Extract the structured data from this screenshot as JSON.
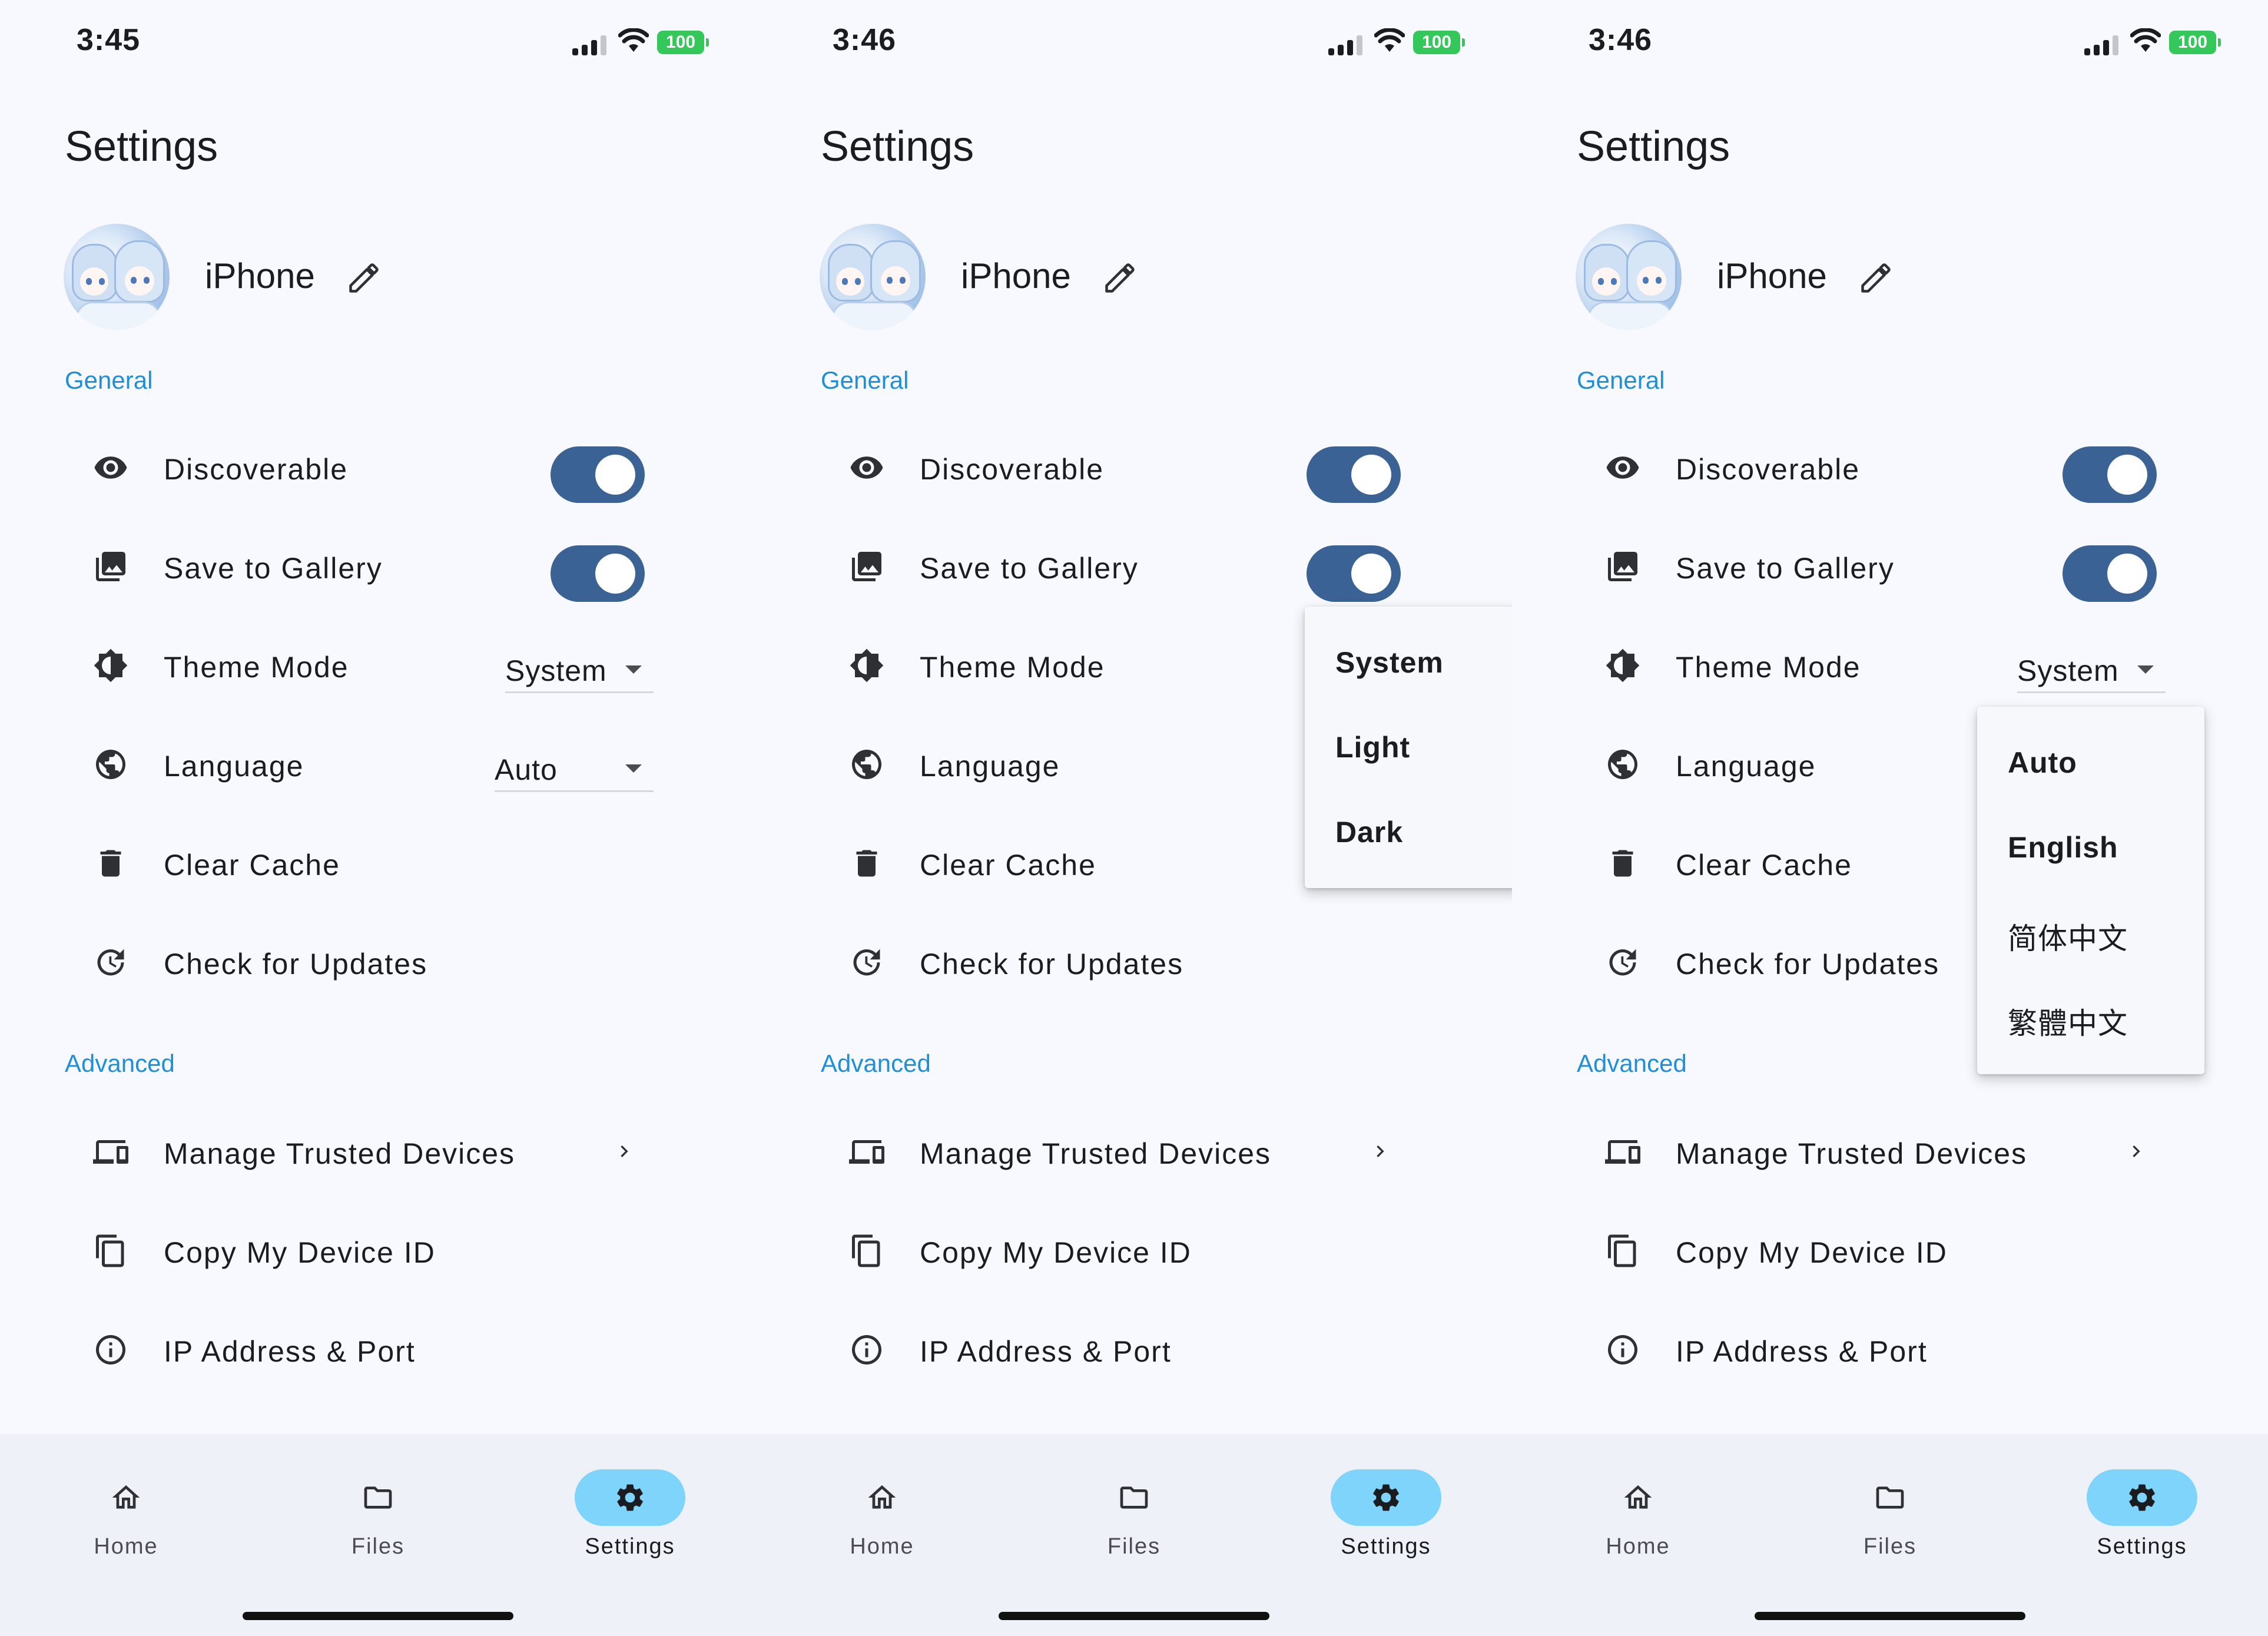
{
  "colors": {
    "accent": "#1f8fd6",
    "toggle_on": "#3a6294",
    "nav_active": "#7fd4fb",
    "battery": "#34c759"
  },
  "screens": [
    {
      "time": "3:45",
      "battery": "100",
      "title": "Settings",
      "device_name": "iPhone",
      "general_label": "General",
      "advanced_label": "Advanced",
      "discoverable": {
        "label": "Discoverable",
        "on": true
      },
      "save_to_gallery": {
        "label": "Save to Gallery",
        "on": true
      },
      "theme_mode": {
        "label": "Theme Mode",
        "value": "System"
      },
      "language": {
        "label": "Language",
        "value": "Auto"
      },
      "clear_cache": "Clear Cache",
      "check_updates": "Check for Updates",
      "manage_devices": "Manage Trusted Devices",
      "copy_id": "Copy My Device ID",
      "ip_port": "IP Address & Port",
      "nav": {
        "home": "Home",
        "files": "Files",
        "settings": "Settings"
      }
    },
    {
      "time": "3:46",
      "battery": "100",
      "title": "Settings",
      "device_name": "iPhone",
      "general_label": "General",
      "advanced_label": "Advanced",
      "discoverable": {
        "label": "Discoverable",
        "on": true
      },
      "save_to_gallery": {
        "label": "Save to Gallery",
        "on": true
      },
      "theme_mode": {
        "label": "Theme Mode"
      },
      "language": {
        "label": "Language"
      },
      "clear_cache": "Clear Cache",
      "check_updates": "Check for Updates",
      "manage_devices": "Manage Trusted Devices",
      "copy_id": "Copy My Device ID",
      "ip_port": "IP Address & Port",
      "theme_menu": [
        "System",
        "Light",
        "Dark"
      ],
      "nav": {
        "home": "Home",
        "files": "Files",
        "settings": "Settings"
      }
    },
    {
      "time": "3:46",
      "battery": "100",
      "title": "Settings",
      "device_name": "iPhone",
      "general_label": "General",
      "advanced_label": "Advanced",
      "discoverable": {
        "label": "Discoverable",
        "on": true
      },
      "save_to_gallery": {
        "label": "Save to Gallery",
        "on": true
      },
      "theme_mode": {
        "label": "Theme Mode",
        "value": "System"
      },
      "language": {
        "label": "Language"
      },
      "clear_cache": "Clear Cache",
      "check_updates": "Check for Updates",
      "manage_devices": "Manage Trusted Devices",
      "copy_id": "Copy My Device ID",
      "ip_port": "IP Address & Port",
      "language_menu": [
        "Auto",
        "English",
        "简体中文",
        "繁體中文"
      ],
      "nav": {
        "home": "Home",
        "files": "Files",
        "settings": "Settings"
      }
    }
  ],
  "icons": {
    "discoverable": "eye-icon",
    "save_to_gallery": "gallery-icon",
    "theme_mode": "theme-icon",
    "language": "globe-icon",
    "clear_cache": "trash-icon",
    "check_updates": "update-icon",
    "manage_devices": "devices-icon",
    "copy_id": "copy-icon",
    "ip_port": "info-icon",
    "edit": "pencil-icon",
    "chevron": "chevron-right-icon",
    "nav_home": "home-icon",
    "nav_files": "folder-icon",
    "nav_settings": "gear-icon"
  }
}
